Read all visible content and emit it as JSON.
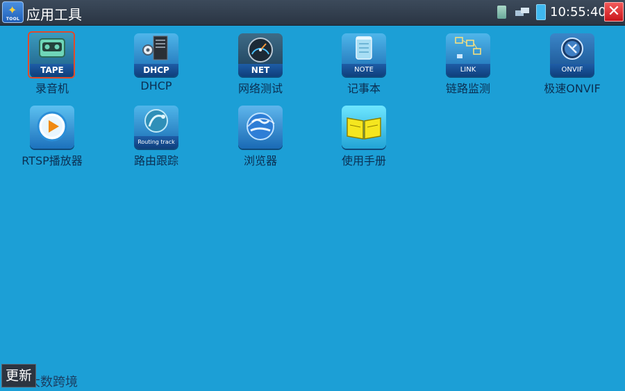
{
  "header": {
    "title": "应用工具",
    "logo_text": "TOOL",
    "time": "10:55:40"
  },
  "apps": [
    {
      "name": "录音机",
      "icon_text": "TAPE",
      "icon": "tape-recorder-icon",
      "selected": true
    },
    {
      "name": "DHCP",
      "icon_text": "DHCP",
      "icon": "server-gear-icon"
    },
    {
      "name": "网络测试",
      "icon_text": "NET",
      "icon": "speedometer-icon"
    },
    {
      "name": "记事本",
      "icon_text": "NOTE",
      "icon": "notebook-icon"
    },
    {
      "name": "链路监测",
      "icon_text": "LINK",
      "icon": "link-diagram-icon"
    },
    {
      "name": "极速ONVIF",
      "icon_text": "ONVIF",
      "icon": "onvif-disc-icon"
    },
    {
      "name": "RTSP播放器",
      "icon_text": "",
      "icon": "play-button-icon"
    },
    {
      "name": "路由跟踪",
      "icon_text": "Routing track",
      "icon": "routing-track-icon"
    },
    {
      "name": "浏览器",
      "icon_text": "",
      "icon": "globe-icon"
    },
    {
      "name": "使用手册",
      "icon_text": "",
      "icon": "open-book-icon"
    }
  ],
  "footer": {
    "update_label": "更新",
    "caption": "大数跨境"
  },
  "colors": {
    "background": "#1c9fd6",
    "topbar": "#2f3b4a",
    "close": "#d81e22",
    "selected_ring": "#e24a2a"
  }
}
